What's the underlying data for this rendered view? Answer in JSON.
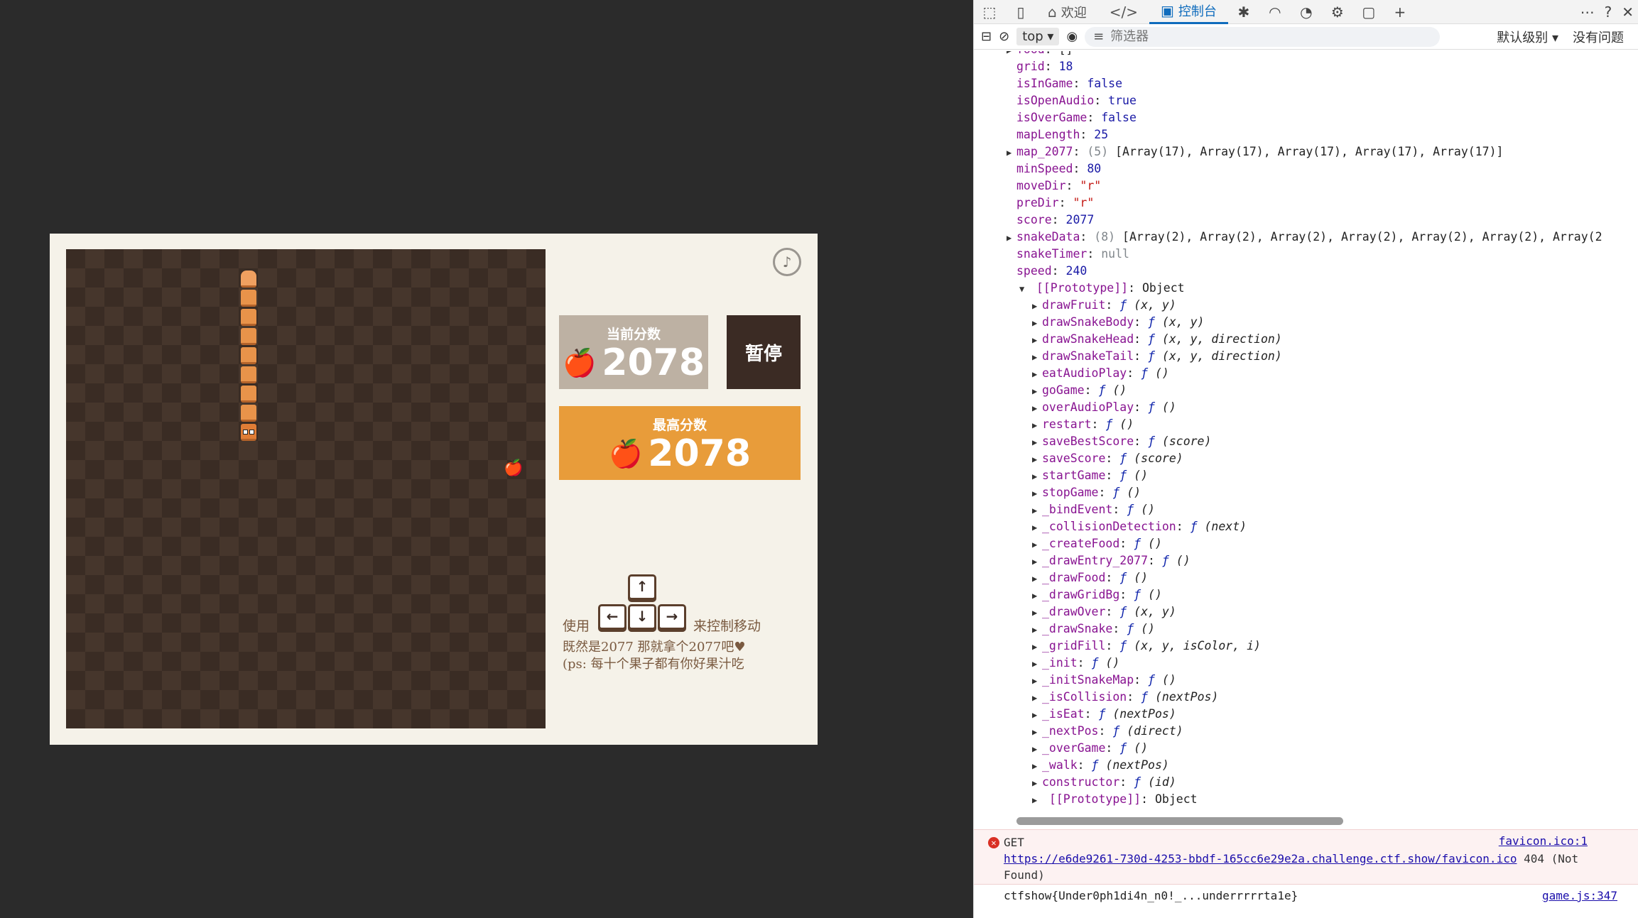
{
  "game": {
    "current_score_label": "当前分数",
    "current_score": "2078",
    "best_score_label": "最高分数",
    "best_score": "2078",
    "pause_label": "暂停",
    "music_icon": "music-note-icon",
    "fruit_icon": "apple-icon",
    "help": {
      "use": "使用",
      "control": "来控制移动",
      "line2": "既然是2077 那就拿个2077吧♥",
      "line3": "(ps: 每十个果子都有你好果汁吃",
      "keys": {
        "up": "↑",
        "left": "←",
        "down": "↓",
        "right": "→"
      }
    }
  },
  "devtools": {
    "tabs": [
      {
        "label": "欢迎",
        "icon": "home-icon"
      },
      {
        "label": "",
        "icon": "code-icon"
      },
      {
        "label": "控制台",
        "icon": "console-icon"
      }
    ],
    "context": "top ▾",
    "filter_placeholder": "筛选器",
    "level": "默认级别 ▾",
    "issues": "没有问题",
    "props": [
      {
        "key": "food",
        "val": "[]",
        "cls": "c",
        "arrow": "▶"
      },
      {
        "key": "grid",
        "val": "18",
        "cls": "num"
      },
      {
        "key": "isInGame",
        "val": "false",
        "cls": "bool"
      },
      {
        "key": "isOpenAudio",
        "val": "true",
        "cls": "bool"
      },
      {
        "key": "isOverGame",
        "val": "false",
        "cls": "bool"
      },
      {
        "key": "mapLength",
        "val": "25",
        "cls": "num"
      },
      {
        "key": "map_2077",
        "cnt": "(5)",
        "val": "[Array(17), Array(17), Array(17), Array(17), Array(17)]",
        "cls": "c",
        "arrow": "▶"
      },
      {
        "key": "minSpeed",
        "val": "80",
        "cls": "num"
      },
      {
        "key": "moveDir",
        "val": "\"r\"",
        "cls": "str"
      },
      {
        "key": "preDir",
        "val": "\"r\"",
        "cls": "str"
      },
      {
        "key": "score",
        "val": "2077",
        "cls": "num"
      },
      {
        "key": "snakeData",
        "cnt": "(8)",
        "val": "[Array(2), Array(2), Array(2), Array(2), Array(2), Array(2), Array(2",
        "cls": "c",
        "arrow": "▶"
      },
      {
        "key": "snakeTimer",
        "val": "null",
        "cls": "nul"
      },
      {
        "key": "speed",
        "val": "240",
        "cls": "num"
      }
    ],
    "proto_label": "[[Prototype]]",
    "proto_val": "Object",
    "methods": [
      {
        "key": "drawFruit",
        "sig": "(x, y)"
      },
      {
        "key": "drawSnakeBody",
        "sig": "(x, y)"
      },
      {
        "key": "drawSnakeHead",
        "sig": "(x, y, direction)"
      },
      {
        "key": "drawSnakeTail",
        "sig": "(x, y, direction)"
      },
      {
        "key": "eatAudioPlay",
        "sig": "()"
      },
      {
        "key": "goGame",
        "sig": "()"
      },
      {
        "key": "overAudioPlay",
        "sig": "()"
      },
      {
        "key": "restart",
        "sig": "()"
      },
      {
        "key": "saveBestScore",
        "sig": "(score)"
      },
      {
        "key": "saveScore",
        "sig": "(score)"
      },
      {
        "key": "startGame",
        "sig": "()"
      },
      {
        "key": "stopGame",
        "sig": "()"
      },
      {
        "key": "_bindEvent",
        "sig": "()"
      },
      {
        "key": "_collisionDetection",
        "sig": "(next)"
      },
      {
        "key": "_createFood",
        "sig": "()"
      },
      {
        "key": "_drawEntry_2077",
        "sig": "()"
      },
      {
        "key": "_drawFood",
        "sig": "()"
      },
      {
        "key": "_drawGridBg",
        "sig": "()"
      },
      {
        "key": "_drawOver",
        "sig": "(x, y)"
      },
      {
        "key": "_drawSnake",
        "sig": "()"
      },
      {
        "key": "_gridFill",
        "sig": "(x, y, isColor, i)"
      },
      {
        "key": "_init",
        "sig": "()"
      },
      {
        "key": "_initSnakeMap",
        "sig": "()"
      },
      {
        "key": "_isCollision",
        "sig": "(nextPos)"
      },
      {
        "key": "_isEat",
        "sig": "(nextPos)"
      },
      {
        "key": "_nextPos",
        "sig": "(direct)"
      },
      {
        "key": "_overGame",
        "sig": "()"
      },
      {
        "key": "_walk",
        "sig": "(nextPos)"
      },
      {
        "key": "constructor",
        "sig": "(id)"
      }
    ],
    "inner_proto_label": "[[Prototype]]",
    "inner_proto_val": "Object",
    "error": {
      "method": "GET",
      "url": "https://e6de9261-730d-4253-bbdf-165cc6e29e2a.challenge.ctf.show/favicon.ico",
      "status": "404 (Not Found)",
      "source": "favicon.ico:1"
    },
    "log": {
      "text": "ctfshow{Under0ph1di4n_n0!_...underrrrrta1e}",
      "source": "game.js:347"
    }
  }
}
